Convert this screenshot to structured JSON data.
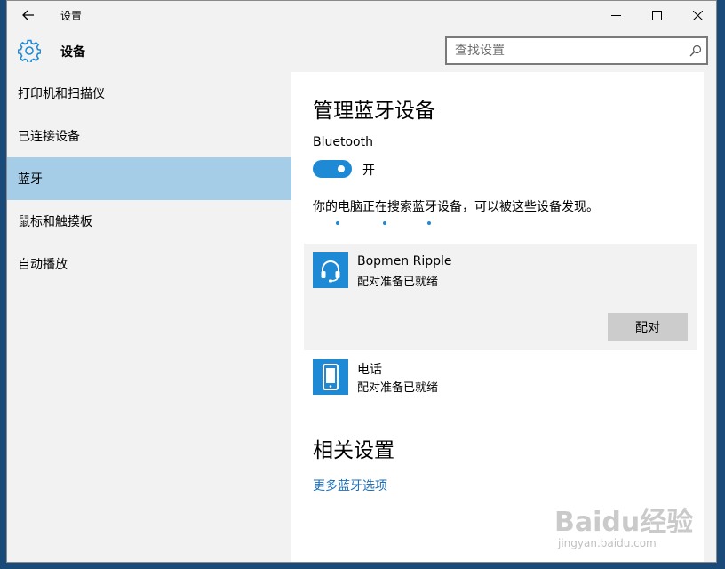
{
  "window": {
    "title": "设置"
  },
  "header": {
    "title": "设备"
  },
  "search": {
    "placeholder": "查找设置"
  },
  "sidebar": {
    "items": [
      {
        "label": "打印机和扫描仪",
        "selected": false
      },
      {
        "label": "已连接设备",
        "selected": false
      },
      {
        "label": "蓝牙",
        "selected": true
      },
      {
        "label": "鼠标和触摸板",
        "selected": false
      },
      {
        "label": "自动播放",
        "selected": false
      }
    ]
  },
  "content": {
    "section_title": "管理蓝牙设备",
    "bluetooth_label": "Bluetooth",
    "toggle_state": "开",
    "toggle_on": true,
    "searching_text": "你的电脑正在搜索蓝牙设备，可以被这些设备发现。",
    "devices": [
      {
        "name": "Bopmen Ripple",
        "status": "配对准备已就绪",
        "icon": "headset-icon",
        "pair_label": "配对"
      },
      {
        "name": "电话",
        "status": "配对准备已就绪",
        "icon": "phone-icon"
      }
    ],
    "related_title": "相关设置",
    "more_link": "更多蓝牙选项"
  },
  "watermark": {
    "brand": "Baidu经验",
    "url": "jingyan.baidu.com"
  },
  "colors": {
    "accent": "#1e8ad6",
    "selected_nav": "#a6cde8",
    "sidebar_bg": "#f2f2f2",
    "link": "#1e6fb5",
    "pair_button": "#cccccc"
  }
}
